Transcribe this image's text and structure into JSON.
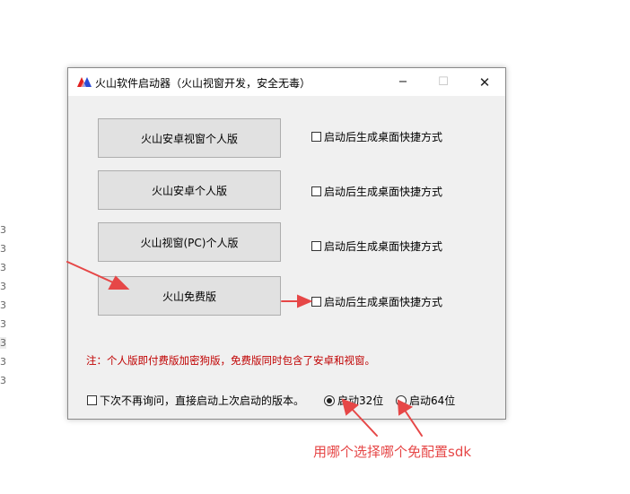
{
  "background": {
    "marks": [
      "3",
      "3",
      "3",
      "3",
      "3",
      "3",
      "3",
      "3",
      "3"
    ]
  },
  "window": {
    "title": "火山软件启动器（火山视窗开发，安全无毒）",
    "controls": {
      "minimize": "−",
      "maximize": "☐",
      "close": "✕"
    },
    "buttons": [
      {
        "label": "火山安卓视窗个人版",
        "shortcut_label": "启动后生成桌面快捷方式",
        "shortcut_checked": false
      },
      {
        "label": "火山安卓个人版",
        "shortcut_label": "启动后生成桌面快捷方式",
        "shortcut_checked": false
      },
      {
        "label": "火山视窗(PC)个人版",
        "shortcut_label": "启动后生成桌面快捷方式",
        "shortcut_checked": false
      },
      {
        "label": "火山免费版",
        "shortcut_label": "启动后生成桌面快捷方式",
        "shortcut_checked": false
      }
    ],
    "note": "注：个人版即付费版加密狗版，免费版同时包含了安卓和视窗。",
    "remember": {
      "label": "下次不再询问，直接启动上次启动的版本。",
      "checked": false
    },
    "arch": [
      {
        "label": "启动32位",
        "selected": true
      },
      {
        "label": "启动64位",
        "selected": false
      }
    ]
  },
  "annotation": {
    "text": "用哪个选择哪个免配置sdk",
    "color": "#e64747"
  },
  "colors": {
    "note": "#c00000",
    "arrow": "#e64747",
    "logo_red": "#e02020",
    "logo_blue": "#2a4bd7"
  }
}
